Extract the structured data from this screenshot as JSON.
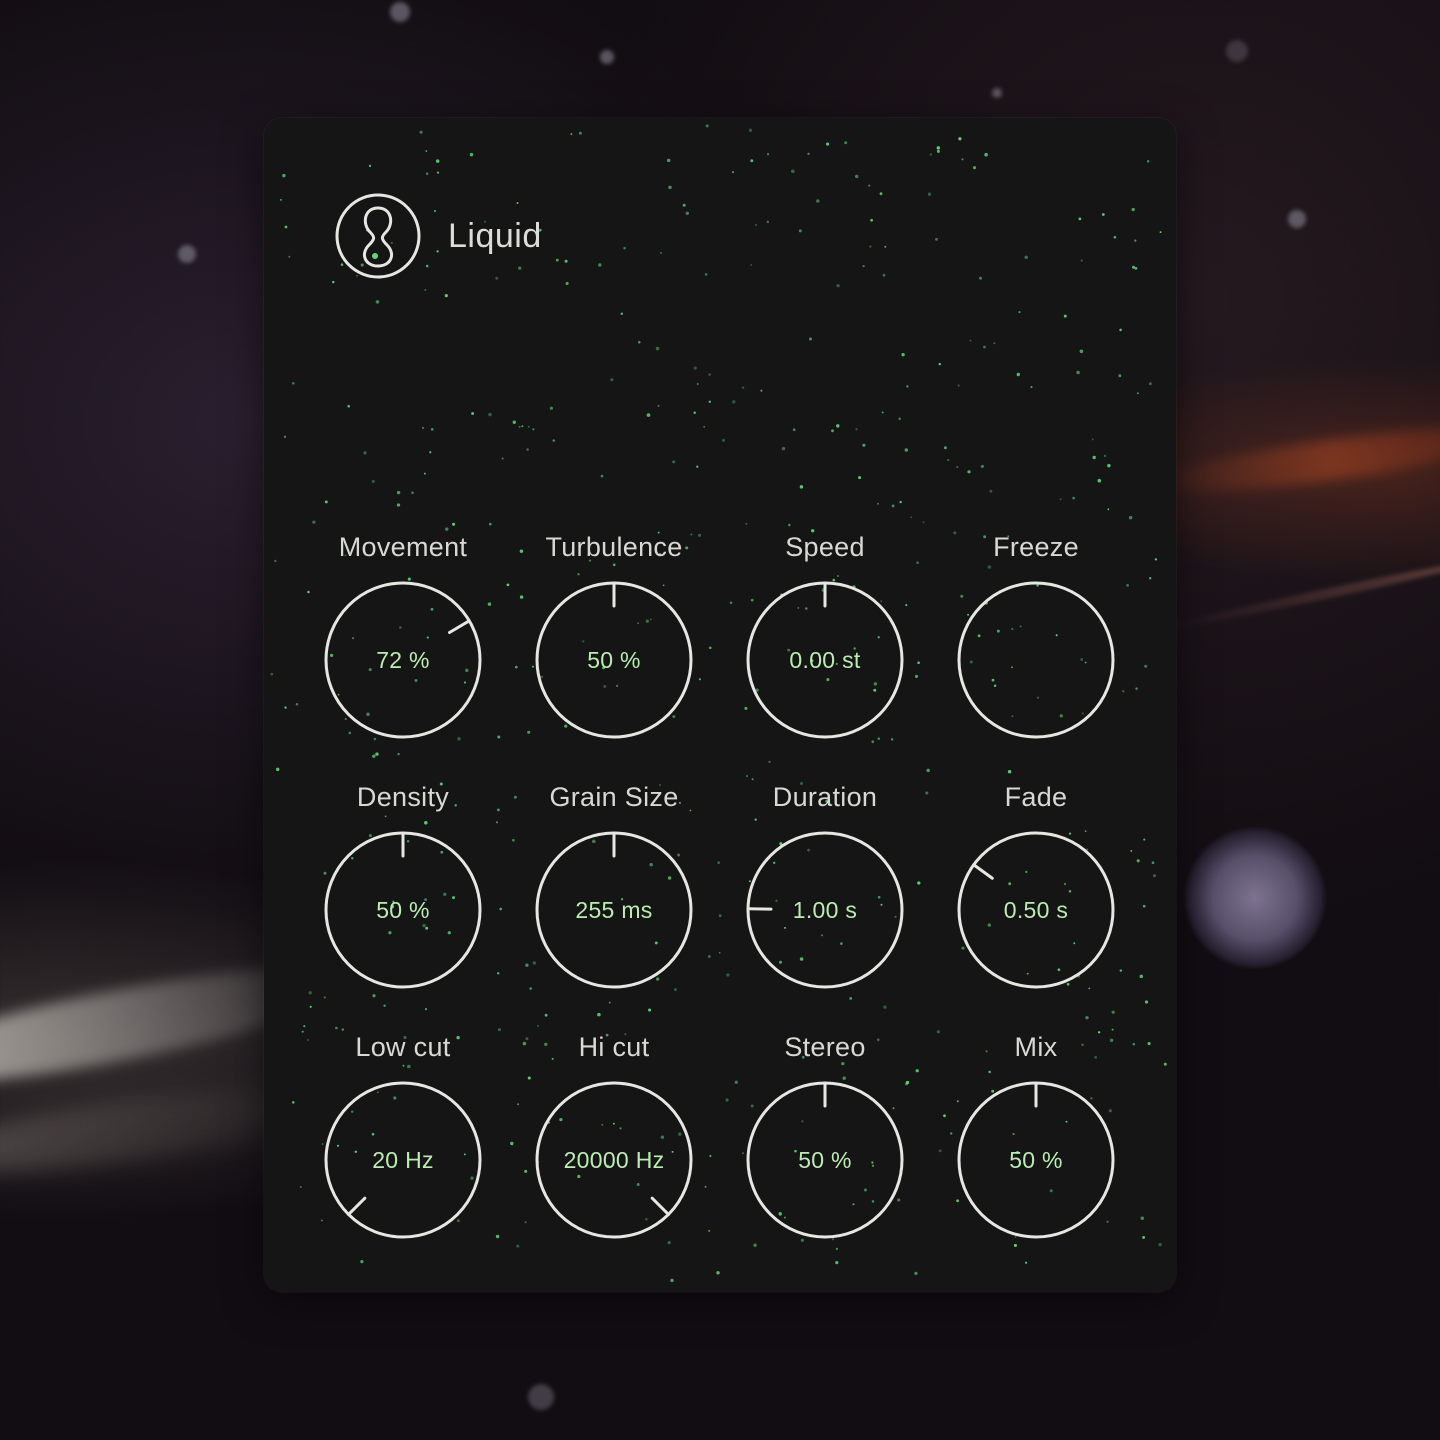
{
  "app": {
    "title": "Liquid",
    "logo_icon": "liquid-drop-icon"
  },
  "colors": {
    "panel": "#151515",
    "knob_ring": "#e6e6e2",
    "value_text": "#b9eeb0",
    "label_text": "#d8d8d4",
    "particle": "#5fdc78"
  },
  "knobs": [
    {
      "id": "movement",
      "label": "Movement",
      "value": "72 %",
      "position": 0.72
    },
    {
      "id": "turbulence",
      "label": "Turbulence",
      "value": "50 %",
      "position": 0.5
    },
    {
      "id": "speed",
      "label": "Speed",
      "value": "0.00 st",
      "position": 0.5
    },
    {
      "id": "freeze",
      "label": "Freeze",
      "value": "",
      "position": null
    },
    {
      "id": "density",
      "label": "Density",
      "value": "50 %",
      "position": 0.5
    },
    {
      "id": "grain-size",
      "label": "Grain Size",
      "value": "255 ms",
      "position": 0.5
    },
    {
      "id": "duration",
      "label": "Duration",
      "value": "1.00 s",
      "position": 0.17
    },
    {
      "id": "fade",
      "label": "Fade",
      "value": "0.50 s",
      "position": 0.3
    },
    {
      "id": "low-cut",
      "label": "Low cut",
      "value": "20 Hz",
      "position": 0.0
    },
    {
      "id": "hi-cut",
      "label": "Hi cut",
      "value": "20000 Hz",
      "position": 1.0
    },
    {
      "id": "stereo",
      "label": "Stereo",
      "value": "50 %",
      "position": 0.5
    },
    {
      "id": "mix",
      "label": "Mix",
      "value": "50 %",
      "position": 0.5
    }
  ]
}
